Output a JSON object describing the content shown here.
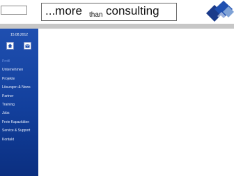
{
  "header": {
    "slogan_more": "...more",
    "slogan_than": "than",
    "slogan_consulting": "consulting"
  },
  "logo": {
    "icon": "company-logo-icon",
    "colors": [
      "#1a3a8a",
      "#7fa2d6"
    ]
  },
  "sidebar": {
    "date": "15.08.2012",
    "icons": [
      "home-icon",
      "mail-icon"
    ],
    "items": [
      {
        "label": "Profil"
      },
      {
        "label": "Unternehmen"
      },
      {
        "label": "Projekte"
      },
      {
        "label": "Lösungen & News"
      },
      {
        "label": "Partner"
      },
      {
        "label": "Training"
      },
      {
        "label": "Jobs"
      },
      {
        "label": "Freie Kapazitäten"
      },
      {
        "label": "Service & Support"
      },
      {
        "label": "Kontakt"
      }
    ]
  },
  "colors": {
    "sidebar_blue": "#1f4fb0",
    "divider_gray": "#c7c7c7"
  }
}
